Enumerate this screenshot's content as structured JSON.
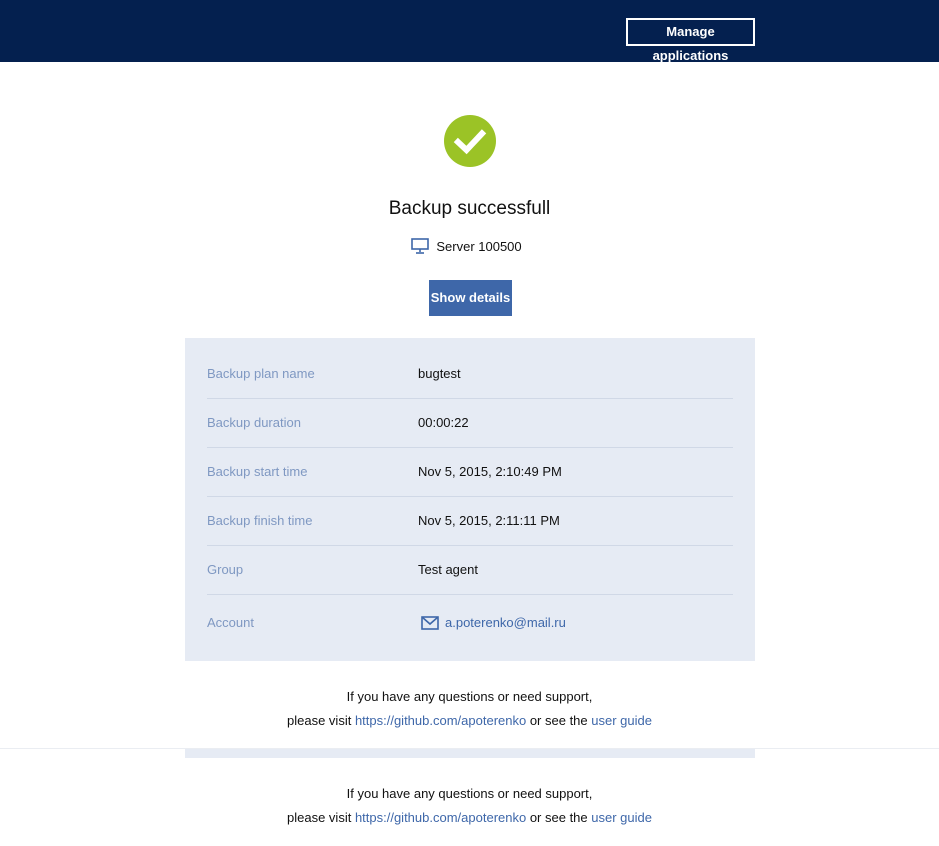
{
  "header": {
    "manage_label": "Manage applications"
  },
  "status": {
    "title": "Backup successfull",
    "server": "Server 100500",
    "show_details_label": "Show details",
    "icon": "checkmark-circle-icon",
    "success_color": "#9bc326"
  },
  "details": {
    "rows": [
      {
        "label": "Backup plan name",
        "value": "bugtest"
      },
      {
        "label": "Backup duration",
        "value": "00:00:22"
      },
      {
        "label": "Backup start time",
        "value": "Nov 5, 2015, 2:10:49 PM"
      },
      {
        "label": "Backup finish time",
        "value": "Nov 5, 2015, 2:11:11 PM"
      },
      {
        "label": "Group",
        "value": "Test agent"
      },
      {
        "label": "Account",
        "value": "a.poterenko@mail.ru"
      }
    ]
  },
  "support": {
    "line1": "If you have any questions or need support,",
    "prefix": "please visit ",
    "link": "https://github.com/apoterenko",
    "middle": " or see the ",
    "guide_link": "user guide"
  },
  "colors": {
    "header_bg": "#04204f",
    "accent": "#3e67a9",
    "panel_bg": "#e6ebf4",
    "label_color": "#7f98c2"
  }
}
